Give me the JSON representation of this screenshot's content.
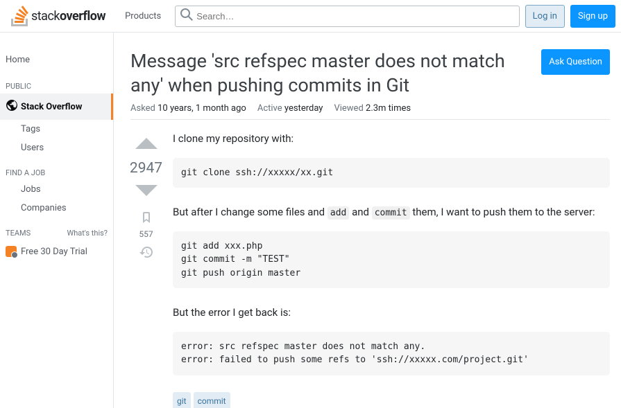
{
  "topbar": {
    "logo_text_thin": "stack",
    "logo_text_bold": "overflow",
    "products": "Products",
    "search_placeholder": "Search…",
    "login": "Log in",
    "signup": "Sign up"
  },
  "sidebar": {
    "home": "Home",
    "public_header": "PUBLIC",
    "stack_overflow": "Stack Overflow",
    "tags": "Tags",
    "users": "Users",
    "findjob_header": "FIND A JOB",
    "jobs": "Jobs",
    "companies": "Companies",
    "teams_header": "TEAMS",
    "teams_help": "What's this?",
    "trial": "Free 30 Day Trial"
  },
  "question": {
    "title": "Message 'src refspec master does not match any' when pushing commits in Git",
    "ask_button": "Ask Question",
    "asked_label": "Asked",
    "asked_value": "10 years, 1 month ago",
    "active_label": "Active",
    "active_value": "yesterday",
    "viewed_label": "Viewed",
    "viewed_value": "2.3m times",
    "vote_count": "2947",
    "bookmark_count": "557",
    "body": {
      "p1": "I clone my repository with:",
      "code1": "git clone ssh://xxxxx/xx.git",
      "p2_pre": "But after I change some files and ",
      "p2_add": "add",
      "p2_mid": " and ",
      "p2_commit": "commit",
      "p2_post": " them, I want to push them to the server:",
      "code2": "git add xxx.php\ngit commit -m \"TEST\"\ngit push origin master",
      "p3": "But the error I get back is:",
      "code3": "error: src refspec master does not match any.\nerror: failed to push some refs to 'ssh://xxxxx.com/project.git'"
    },
    "tags": [
      "git",
      "commit"
    ]
  }
}
